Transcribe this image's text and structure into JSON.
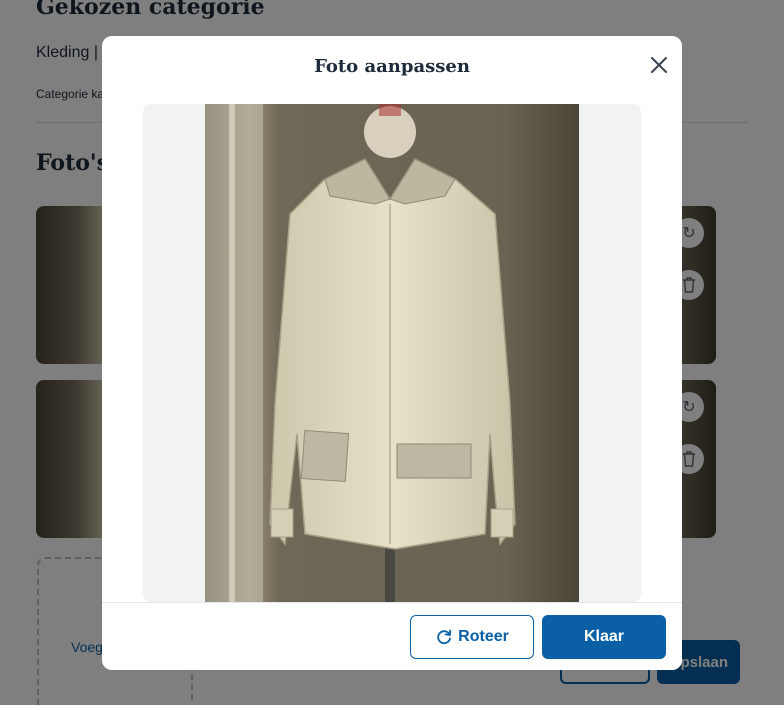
{
  "background": {
    "category_heading": "Gekozen categorie",
    "category_value": "Kleding |",
    "category_small": "Categorie ka",
    "photos_heading": "Foto's",
    "upload_label": "Voeg",
    "save_button_partial": "pslaan",
    "photo_tools": {
      "rotate_icon": "rotate-icon",
      "delete_icon": "trash-icon"
    }
  },
  "modal": {
    "title": "Foto aanpassen",
    "close_icon": "close-icon",
    "rotate_button": "Roteer",
    "done_button": "Klaar"
  },
  "colors": {
    "primary": "#0b5fa5",
    "overlay": "rgba(0,0,0,0.5)",
    "image_backdrop": "#f1f2f2"
  }
}
